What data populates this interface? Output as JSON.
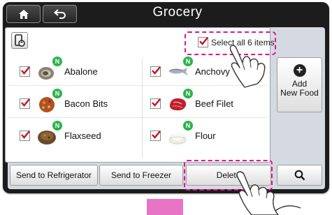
{
  "header": {
    "title": "Grocery"
  },
  "toolbar": {
    "select_all_label": "Select all 6 items"
  },
  "items": [
    {
      "label": "Abalone",
      "badge": "N",
      "checked": true,
      "icon": "abalone-icon"
    },
    {
      "label": "Anchovy",
      "badge": "N",
      "checked": true,
      "icon": "anchovy-icon"
    },
    {
      "label": "Bacon Bits",
      "badge": "N",
      "checked": true,
      "icon": "bacon-bits-icon"
    },
    {
      "label": "Beef Filet",
      "badge": "N",
      "checked": true,
      "icon": "beef-filet-icon"
    },
    {
      "label": "Flaxseed",
      "badge": "N",
      "checked": true,
      "icon": "flaxseed-icon"
    },
    {
      "label": "Flour",
      "badge": "N",
      "checked": true,
      "icon": "flour-icon"
    }
  ],
  "side": {
    "add_label_1": "Add",
    "add_label_2": "New Food"
  },
  "footer": {
    "refrigerator_label": "Send to Refrigerator",
    "freezer_label": "Send to Freezer",
    "delete_label": "Delete"
  },
  "colors": {
    "accent": "#e6128a",
    "badge": "#2bb34a",
    "check": "#c8102e",
    "frame": "#1c1c1c"
  }
}
